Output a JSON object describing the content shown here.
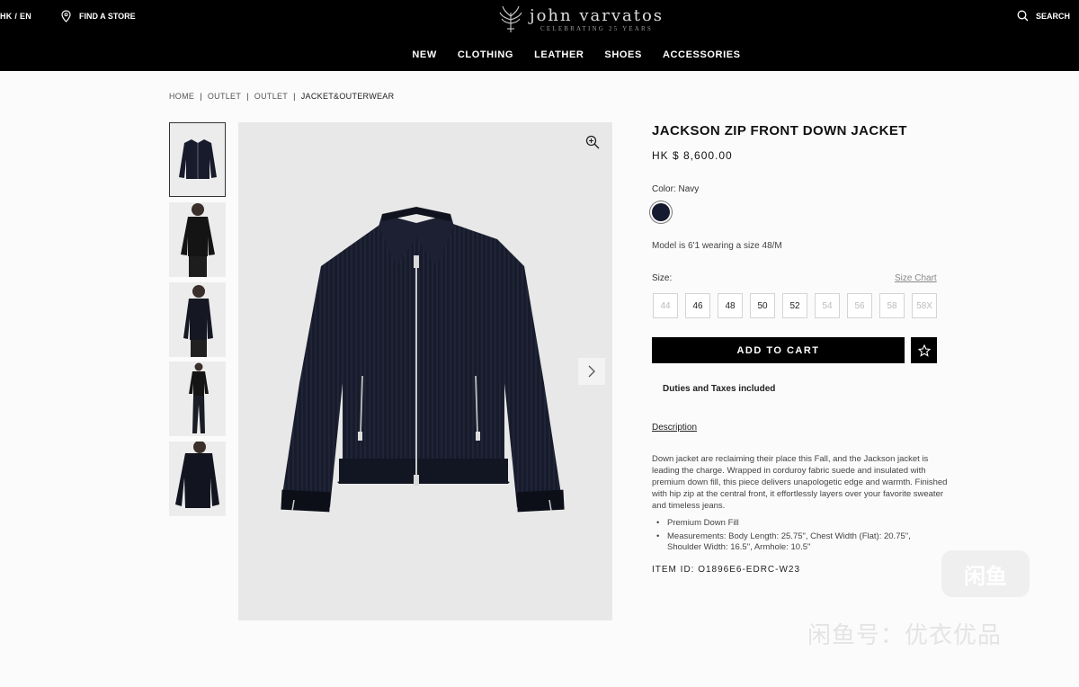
{
  "header": {
    "locale": "HK / EN",
    "find_store": "FIND A STORE",
    "brand": "john varvatos",
    "brand_tagline": "CELEBRATING 25 YEARS",
    "search": "SEARCH",
    "nav": [
      "NEW",
      "CLOTHING",
      "LEATHER",
      "SHOES",
      "ACCESSORIES"
    ]
  },
  "breadcrumb": {
    "items": [
      "HOME",
      "OUTLET",
      "OUTLET",
      "JACKET&OUTERWEAR"
    ],
    "separator": "|"
  },
  "gallery": {
    "thumbnails": [
      "jacket-front",
      "model-front",
      "model-side",
      "model-full",
      "jacket-back"
    ],
    "selected_index": 0
  },
  "product": {
    "title": "JACKSON ZIP FRONT DOWN JACKET",
    "price": "HK $ 8,600.00",
    "color_label": "Color:",
    "color_value": "Navy",
    "swatch_color": "#151a2e",
    "model_info": "Model is 6'1 wearing a size 48/M",
    "size_label": "Size:",
    "size_chart": "Size Chart",
    "sizes": [
      {
        "label": "44",
        "available": false
      },
      {
        "label": "46",
        "available": true
      },
      {
        "label": "48",
        "available": true
      },
      {
        "label": "50",
        "available": true
      },
      {
        "label": "52",
        "available": true
      },
      {
        "label": "54",
        "available": false
      },
      {
        "label": "56",
        "available": false
      },
      {
        "label": "58",
        "available": false
      },
      {
        "label": "58X",
        "available": false
      }
    ],
    "add_to_cart": "ADD TO CART",
    "duties": "Duties and Taxes included",
    "description_heading": "Description",
    "description": "Down jacket are reclaiming their place this Fall, and the Jackson jacket is leading the charge. Wrapped in corduroy fabric suede and insulated with premium down fill, this piece delivers unapologetic edge and warmth. Finished with hip zip at the central front, it effortlessly layers over your favorite sweater and timeless jeans.",
    "bullets": [
      "Premium Down Fill",
      "Measurements: Body Length: 25.75\", Chest Width (Flat): 20.75\", Shoulder Width: 16.5\", Armhole: 10.5\""
    ],
    "item_id": "ITEM ID: O1896E6-EDRC-W23"
  },
  "watermark": {
    "badge": "闲鱼",
    "text": "闲鱼号：优衣优品"
  },
  "colors": {
    "header_bg": "#000000",
    "accent": "#000000",
    "jacket": "#161a2a"
  }
}
